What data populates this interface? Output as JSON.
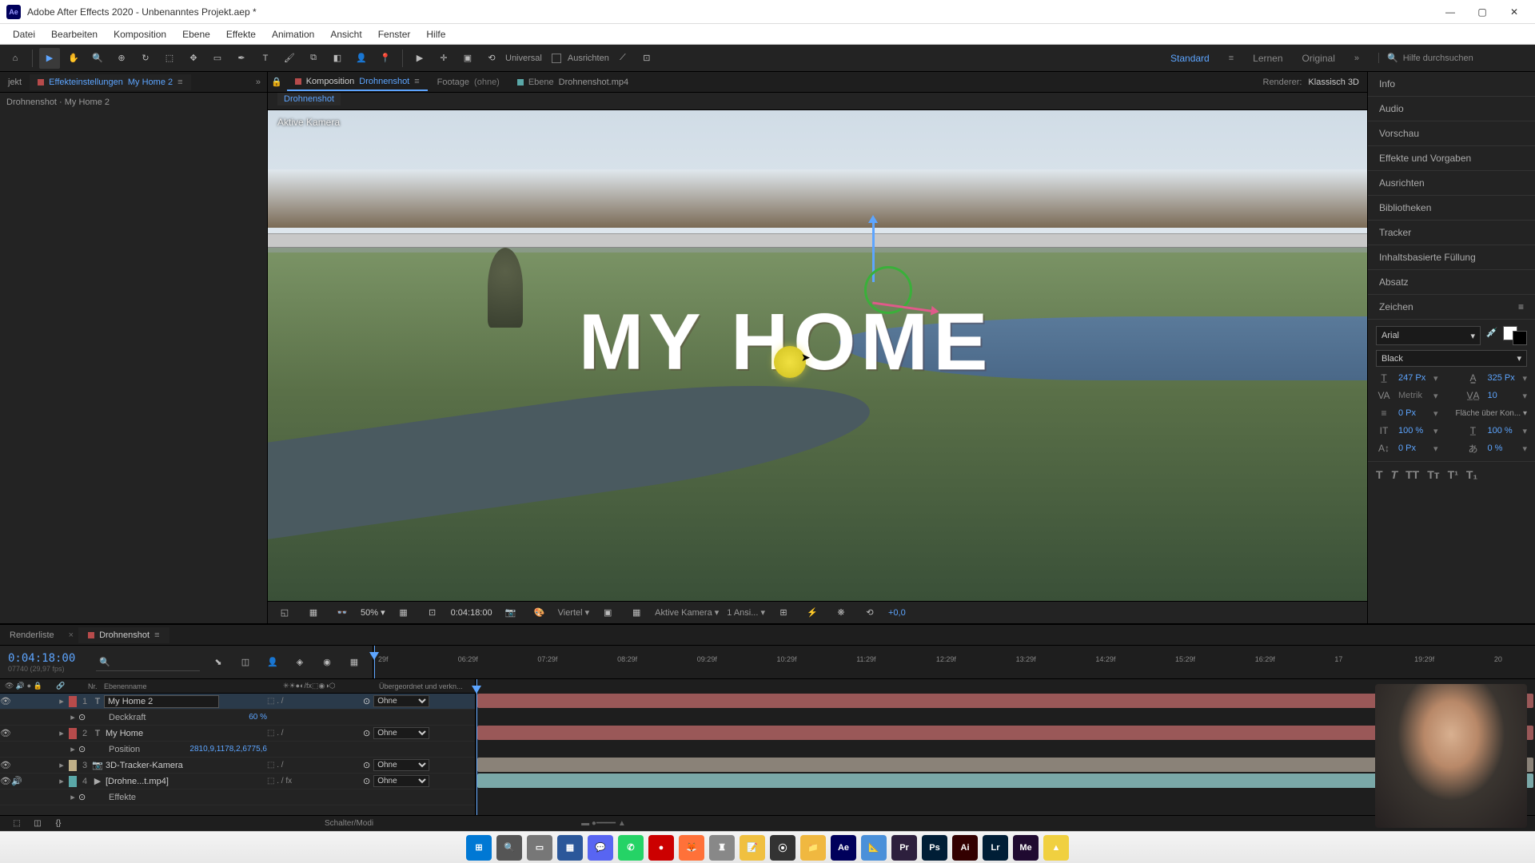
{
  "titlebar": {
    "app": "Adobe After Effects 2020",
    "project": "Unbenanntes Projekt.aep *"
  },
  "menu": [
    "Datei",
    "Bearbeiten",
    "Komposition",
    "Ebene",
    "Effekte",
    "Animation",
    "Ansicht",
    "Fenster",
    "Hilfe"
  ],
  "toolbar": {
    "universal": "Universal",
    "align": "Ausrichten"
  },
  "workspaces": {
    "active": "Standard",
    "others": [
      "Lernen",
      "Original"
    ]
  },
  "search_placeholder": "Hilfe durchsuchen",
  "leftpanel": {
    "tab_project": "jekt",
    "tab_effects": "Effekteinstellungen",
    "tab_effects_comp": "My Home 2",
    "breadcrumb": "Drohnenshot · My Home 2"
  },
  "center": {
    "tab_comp_label": "Komposition",
    "tab_comp_name": "Drohnenshot",
    "tab_footage_label": "Footage",
    "tab_footage_name": "(ohne)",
    "tab_layer_label": "Ebene",
    "tab_layer_name": "Drohnenshot.mp4",
    "renderer_label": "Renderer:",
    "renderer_value": "Klassisch 3D",
    "subnav": "Drohnenshot",
    "camera_label": "Aktive Kamera",
    "text": "MY HOME"
  },
  "viewport_bar": {
    "zoom": "50%",
    "timecode": "0:04:18:00",
    "res": "Viertel",
    "camera": "Aktive Kamera",
    "views": "1 Ansi...",
    "exposure": "+0,0"
  },
  "rightpanels": [
    "Info",
    "Audio",
    "Vorschau",
    "Effekte und Vorgaben",
    "Ausrichten",
    "Bibliotheken",
    "Tracker",
    "Inhaltsbasierte Füllung",
    "Absatz"
  ],
  "char": {
    "title": "Zeichen",
    "font": "Arial",
    "style": "Black",
    "size": "247 Px",
    "leading": "325 Px",
    "kerning": "Metrik",
    "tracking": "10",
    "stroke": "0 Px",
    "stroke_mode": "Fläche über Kon...",
    "hscale": "100 %",
    "vscale": "100 %",
    "baseline": "0 Px",
    "tsume": "0 %"
  },
  "timeline": {
    "tab_render": "Renderliste",
    "tab_comp": "Drohnenshot",
    "timecode": "0:04:18:00",
    "fps": "07740 (29,97 fps)",
    "col_num": "Nr.",
    "col_name": "Ebenenname",
    "col_parent": "Übergeordnet und verkn...",
    "ruler": [
      "29f",
      "06:29f",
      "07:29f",
      "08:29f",
      "09:29f",
      "10:29f",
      "11:29f",
      "12:29f",
      "13:29f",
      "14:29f",
      "15:29f",
      "16:29f",
      "17",
      "19:29f",
      "20"
    ],
    "layers": [
      {
        "num": "1",
        "icon": "T",
        "name": "My Home 2",
        "sel": true,
        "color": "#b74b4b",
        "eye": true,
        "parent": "Ohne"
      },
      {
        "sub": true,
        "name": "Deckkraft",
        "val": "60 %"
      },
      {
        "num": "2",
        "icon": "T",
        "name": "My Home",
        "color": "#b74b4b",
        "eye": true,
        "parent": "Ohne"
      },
      {
        "sub": true,
        "name": "Position",
        "val": "2810,9,1178,2,6775,6"
      },
      {
        "num": "3",
        "icon": "📷",
        "name": "3D-Tracker-Kamera",
        "color": "#c0b088",
        "eye": true,
        "parent": "Ohne"
      },
      {
        "num": "4",
        "icon": "▶",
        "name": "[Drohne...t.mp4]",
        "color": "#5aa8a8",
        "eye": true,
        "spk": true,
        "parent": "Ohne",
        "fx": true
      },
      {
        "sub": true,
        "name": "Effekte"
      }
    ],
    "footer": "Schalter/Modi"
  },
  "taskbar": [
    {
      "bg": "#0078d4",
      "t": "⊞"
    },
    {
      "bg": "#555",
      "t": "🔍"
    },
    {
      "bg": "#777",
      "t": "▭"
    },
    {
      "bg": "#2b579a",
      "t": "▦"
    },
    {
      "bg": "#5865f2",
      "t": "💬"
    },
    {
      "bg": "#25d366",
      "t": "✆"
    },
    {
      "bg": "#cc0000",
      "t": "●"
    },
    {
      "bg": "#ff7139",
      "t": "🦊"
    },
    {
      "bg": "#888",
      "t": "♜"
    },
    {
      "bg": "#f0c040",
      "t": "📝"
    },
    {
      "bg": "#333",
      "t": "⦿"
    },
    {
      "bg": "#f0b840",
      "t": "📁"
    },
    {
      "bg": "#00005b",
      "t": "Ae"
    },
    {
      "bg": "#4a90d9",
      "t": "📐"
    },
    {
      "bg": "#2d1f3d",
      "t": "Pr"
    },
    {
      "bg": "#001e36",
      "t": "Ps"
    },
    {
      "bg": "#330000",
      "t": "Ai"
    },
    {
      "bg": "#001e36",
      "t": "Lr"
    },
    {
      "bg": "#1f0a30",
      "t": "Me"
    },
    {
      "bg": "#f0d040",
      "t": "▲"
    }
  ]
}
